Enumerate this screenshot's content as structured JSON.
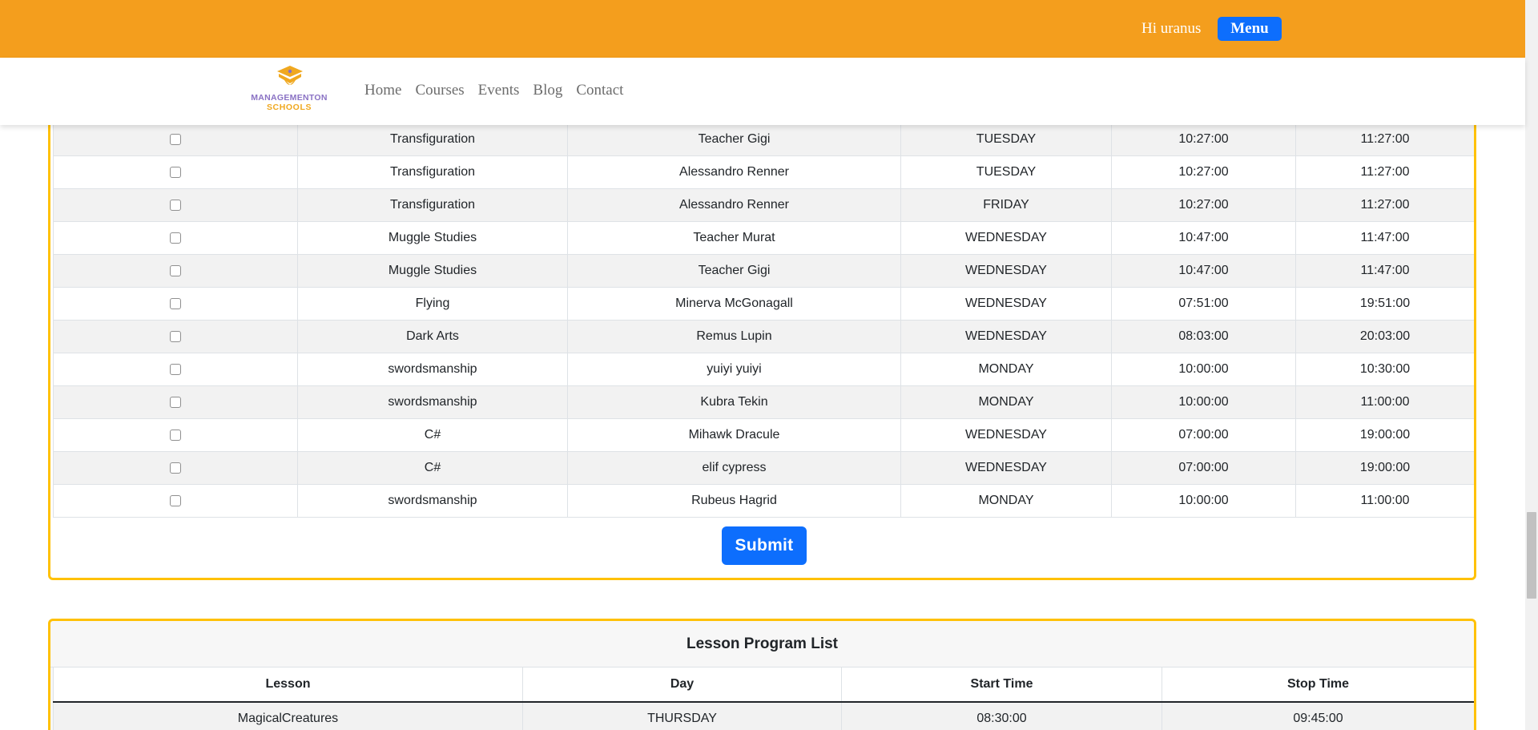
{
  "header": {
    "greeting": "Hi uranus",
    "menu_label": "Menu"
  },
  "logo": {
    "line1": "MANAGEMENTON",
    "line2": "SCHOOLS"
  },
  "nav": {
    "items": [
      "Home",
      "Courses",
      "Events",
      "Blog",
      "Contact"
    ]
  },
  "lesson_selection": {
    "rows": [
      {
        "lesson": "Transfiguration",
        "teacher": "Teacher Gigi",
        "day": "TUESDAY",
        "start": "10:27:00",
        "stop": "11:27:00"
      },
      {
        "lesson": "Transfiguration",
        "teacher": "Alessandro Renner",
        "day": "TUESDAY",
        "start": "10:27:00",
        "stop": "11:27:00"
      },
      {
        "lesson": "Transfiguration",
        "teacher": "Alessandro Renner",
        "day": "FRIDAY",
        "start": "10:27:00",
        "stop": "11:27:00"
      },
      {
        "lesson": "Muggle Studies",
        "teacher": "Teacher Murat",
        "day": "WEDNESDAY",
        "start": "10:47:00",
        "stop": "11:47:00"
      },
      {
        "lesson": "Muggle Studies",
        "teacher": "Teacher Gigi",
        "day": "WEDNESDAY",
        "start": "10:47:00",
        "stop": "11:47:00"
      },
      {
        "lesson": "Flying",
        "teacher": "Minerva McGonagall",
        "day": "WEDNESDAY",
        "start": "07:51:00",
        "stop": "19:51:00"
      },
      {
        "lesson": "Dark Arts",
        "teacher": "Remus Lupin",
        "day": "WEDNESDAY",
        "start": "08:03:00",
        "stop": "20:03:00"
      },
      {
        "lesson": "swordsmanship",
        "teacher": "yuiyi yuiyi",
        "day": "MONDAY",
        "start": "10:00:00",
        "stop": "10:30:00"
      },
      {
        "lesson": "swordsmanship",
        "teacher": "Kubra Tekin",
        "day": "MONDAY",
        "start": "10:00:00",
        "stop": "11:00:00"
      },
      {
        "lesson": "C#",
        "teacher": "Mihawk Dracule",
        "day": "WEDNESDAY",
        "start": "07:00:00",
        "stop": "19:00:00"
      },
      {
        "lesson": "C#",
        "teacher": "elif cypress",
        "day": "WEDNESDAY",
        "start": "07:00:00",
        "stop": "19:00:00"
      },
      {
        "lesson": "swordsmanship",
        "teacher": "Rubeus Hagrid",
        "day": "MONDAY",
        "start": "10:00:00",
        "stop": "11:00:00"
      }
    ],
    "submit_label": "Submit"
  },
  "lesson_program_list": {
    "title": "Lesson Program List",
    "columns": [
      "Lesson",
      "Day",
      "Start Time",
      "Stop Time"
    ],
    "rows": [
      {
        "lesson": "MagicalCreatures",
        "day": "THURSDAY",
        "start": "08:30:00",
        "stop": "09:45:00"
      }
    ]
  },
  "colors": {
    "topbar": "#f49e1d",
    "primary_button": "#0d6efd",
    "card_border": "#ffc107"
  }
}
